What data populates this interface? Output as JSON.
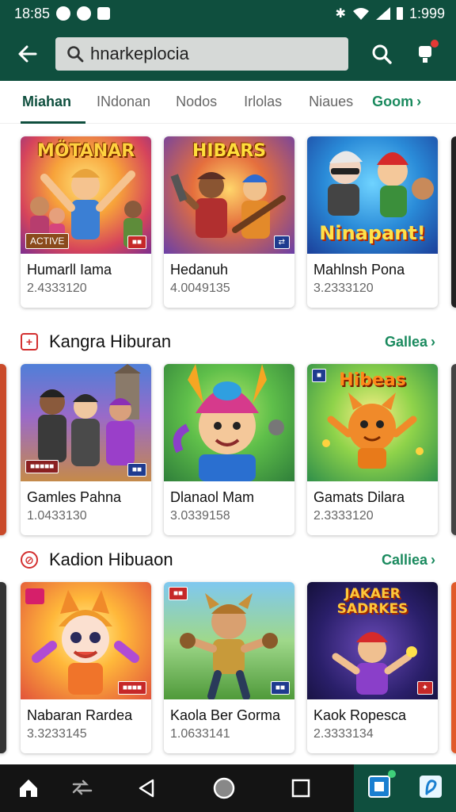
{
  "status_bar": {
    "time": "18:85",
    "right_time": "1:999"
  },
  "header": {
    "search_value": "hnarkeplocia"
  },
  "tabs": [
    {
      "label": "Miahan"
    },
    {
      "label": "INdonan"
    },
    {
      "label": "Nodos"
    },
    {
      "label": "Irlolas"
    },
    {
      "label": "Niaues"
    },
    {
      "label": "Goom"
    }
  ],
  "sections": [
    {
      "title": "",
      "cards": [
        {
          "title": "Humarll Iama",
          "sub": "2.4333120",
          "art": "MÖTANAR",
          "tag": "ACTIVE"
        },
        {
          "title": "Hedanuh",
          "sub": "4.0049135",
          "art": "HIBARS",
          "tag": ""
        },
        {
          "title": "Mahlnsh Pona",
          "sub": "3.2333120",
          "art": "Ninapant!",
          "tag": ""
        }
      ]
    },
    {
      "title": "Kangra Hiburan",
      "see_all": "Gallea",
      "cards": [
        {
          "title": "Gamles Pahna",
          "sub": "1.0433130",
          "art": "",
          "tag": ""
        },
        {
          "title": "Dlanaol Mam",
          "sub": "3.0339158",
          "art": "",
          "tag": ""
        },
        {
          "title": "Gamats Dilara",
          "sub": "2.3333120",
          "art": "Hibeas",
          "tag": ""
        }
      ]
    },
    {
      "title": "Kadion Hibuaon",
      "see_all": "Calliea",
      "cards": [
        {
          "title": "Nabaran Rardea",
          "sub": "3.3233145",
          "art": "",
          "tag": ""
        },
        {
          "title": "Kaola Ber Gorma",
          "sub": "1.0633141",
          "art": "",
          "tag": ""
        },
        {
          "title": "Kaok Ropesca",
          "sub": "2.3333134",
          "art": "JAKAER SADRKES",
          "tag": ""
        }
      ]
    }
  ],
  "colors": {
    "primary": "#0f4f3e",
    "accent": "#1a8a5e",
    "badge": "#d32f2f"
  }
}
